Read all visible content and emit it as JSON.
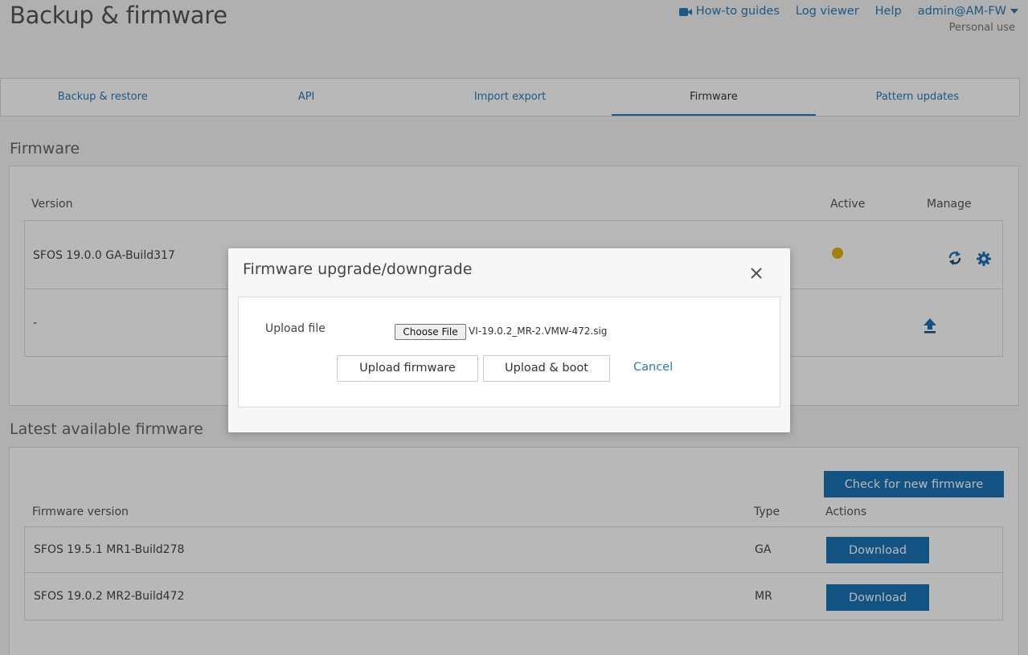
{
  "header": {
    "title": "Backup & firmware",
    "nav": {
      "how_to_guides": "How-to guides",
      "log_viewer": "Log viewer",
      "help": "Help",
      "user": "admin@AM-FW"
    },
    "subline": "Personal use"
  },
  "tabs": [
    {
      "label": "Backup & restore"
    },
    {
      "label": "API"
    },
    {
      "label": "Import export"
    },
    {
      "label": "Firmware",
      "active": true
    },
    {
      "label": "Pattern updates"
    }
  ],
  "firmware_section": {
    "title": "Firmware",
    "headers": {
      "version": "Version",
      "active": "Active",
      "manage": "Manage"
    },
    "rows": [
      {
        "version": "SFOS 19.0.0 GA-Build317"
      },
      {
        "version": "-"
      }
    ]
  },
  "latest_section": {
    "title": "Latest available firmware",
    "check_button": "Check for new firmware",
    "headers": {
      "version": "Firmware version",
      "type": "Type",
      "actions": "Actions"
    },
    "rows": [
      {
        "version": "SFOS 19.5.1 MR1-Build278",
        "type": "GA",
        "action": "Download"
      },
      {
        "version": "SFOS 19.0.2 MR2-Build472",
        "type": "MR",
        "action": "Download"
      }
    ]
  },
  "modal": {
    "title": "Firmware upgrade/downgrade",
    "upload_label": "Upload file",
    "choose_file": "Choose File",
    "file_name": "VI-19.0.2_MR-2.VMW-472.sig",
    "upload_firmware": "Upload firmware",
    "upload_boot": "Upload & boot",
    "cancel": "Cancel"
  },
  "colors": {
    "accent": "#1a73b6",
    "link": "#2a7ab8",
    "active_dot": "#e2b410"
  }
}
